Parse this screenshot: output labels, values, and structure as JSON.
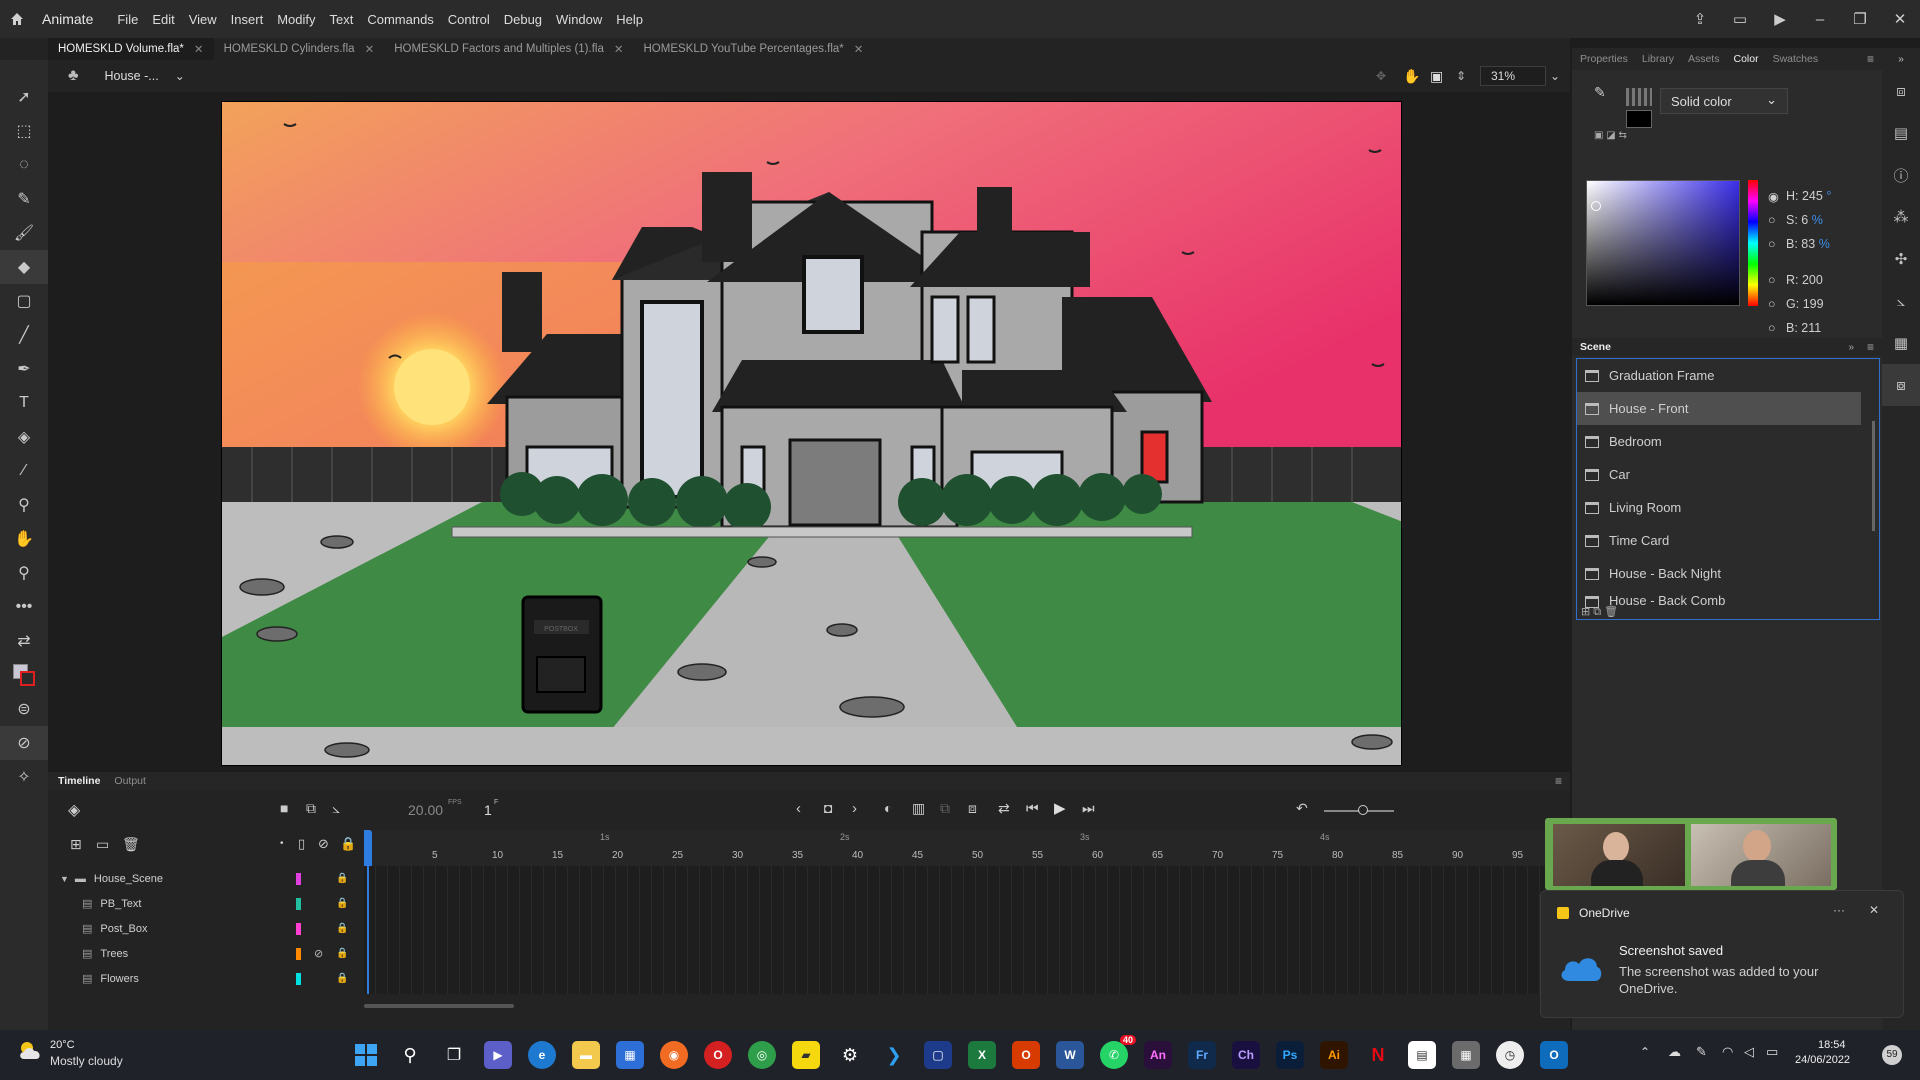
{
  "app": {
    "name": "Animate",
    "menu": [
      "File",
      "Edit",
      "View",
      "Insert",
      "Modify",
      "Text",
      "Commands",
      "Control",
      "Debug",
      "Window",
      "Help"
    ]
  },
  "tabs": [
    {
      "label": "HOMESKLD Volume.fla*",
      "active": true
    },
    {
      "label": "HOMESKLD Cylinders.fla",
      "active": false
    },
    {
      "label": "HOMESKLD Factors and Multiples (1).fla",
      "active": false
    },
    {
      "label": "HOMESKLD YouTube Percentages.fla*",
      "active": false
    }
  ],
  "editbar": {
    "scene_name": "House -...",
    "zoom": "31%"
  },
  "stage": {
    "postbox_label": "POSTBOX"
  },
  "panels": {
    "tabs": [
      "Properties",
      "Library",
      "Assets",
      "Color",
      "Swatches"
    ],
    "active_tab": "Color",
    "color": {
      "type": "Solid color",
      "fields": [
        {
          "label": "H:",
          "value": "245",
          "unit": "°"
        },
        {
          "label": "S:",
          "value": "6",
          "unit": "%"
        },
        {
          "label": "B:",
          "value": "83",
          "unit": "%"
        },
        {
          "label": "R:",
          "value": "200",
          "unit": ""
        },
        {
          "label": "G:",
          "value": "199",
          "unit": ""
        },
        {
          "label": "B:",
          "value": "211",
          "unit": ""
        }
      ]
    },
    "scene": {
      "title": "Scene",
      "items": [
        "Graduation Frame",
        "House - Front",
        "Bedroom",
        "Car",
        "Living Room",
        "Time Card",
        "House - Back Night",
        "House - Back Comb"
      ],
      "selected": "House - Front"
    }
  },
  "timeline": {
    "tabs": [
      "Timeline",
      "Output"
    ],
    "fps": "20.00",
    "fps_unit": "FPS",
    "frame": "1",
    "frame_unit": "F",
    "ruler": [
      "5",
      "10",
      "15",
      "20",
      "25",
      "30",
      "35",
      "40",
      "45",
      "50",
      "55",
      "60",
      "65",
      "70",
      "75",
      "80",
      "85",
      "90",
      "95"
    ],
    "seconds": [
      "1s",
      "2s",
      "3s",
      "4s"
    ],
    "layers": [
      {
        "name": "House_Scene",
        "type": "folder",
        "color": "#e040e0"
      },
      {
        "name": "PB_Text",
        "type": "layer",
        "color": "#20c0a0"
      },
      {
        "name": "Post_Box",
        "type": "layer",
        "color": "#ff40d0"
      },
      {
        "name": "Trees",
        "type": "layer",
        "color": "#ff8a00"
      },
      {
        "name": "Flowers",
        "type": "layer",
        "color": "#00e0e0"
      }
    ]
  },
  "toast": {
    "app": "OneDrive",
    "title": "Screenshot saved",
    "message": "The screenshot was added to your OneDrive."
  },
  "taskbar": {
    "weather_temp": "20°C",
    "weather_desc": "Mostly cloudy",
    "time": "18:54",
    "date": "24/06/2022",
    "whatsapp_badge": "40",
    "notif_count": "59",
    "apps": [
      {
        "name": "An",
        "color": "#2a0f3a",
        "fg": "#ff6fff"
      },
      {
        "name": "Fr",
        "color": "#0f2a4a",
        "fg": "#61a8ff"
      },
      {
        "name": "Ch",
        "color": "#1a1040",
        "fg": "#b89cff"
      },
      {
        "name": "Ps",
        "color": "#0a1e3a",
        "fg": "#31a8ff"
      },
      {
        "name": "Ai",
        "color": "#2f1500",
        "fg": "#ff9a00"
      }
    ]
  }
}
